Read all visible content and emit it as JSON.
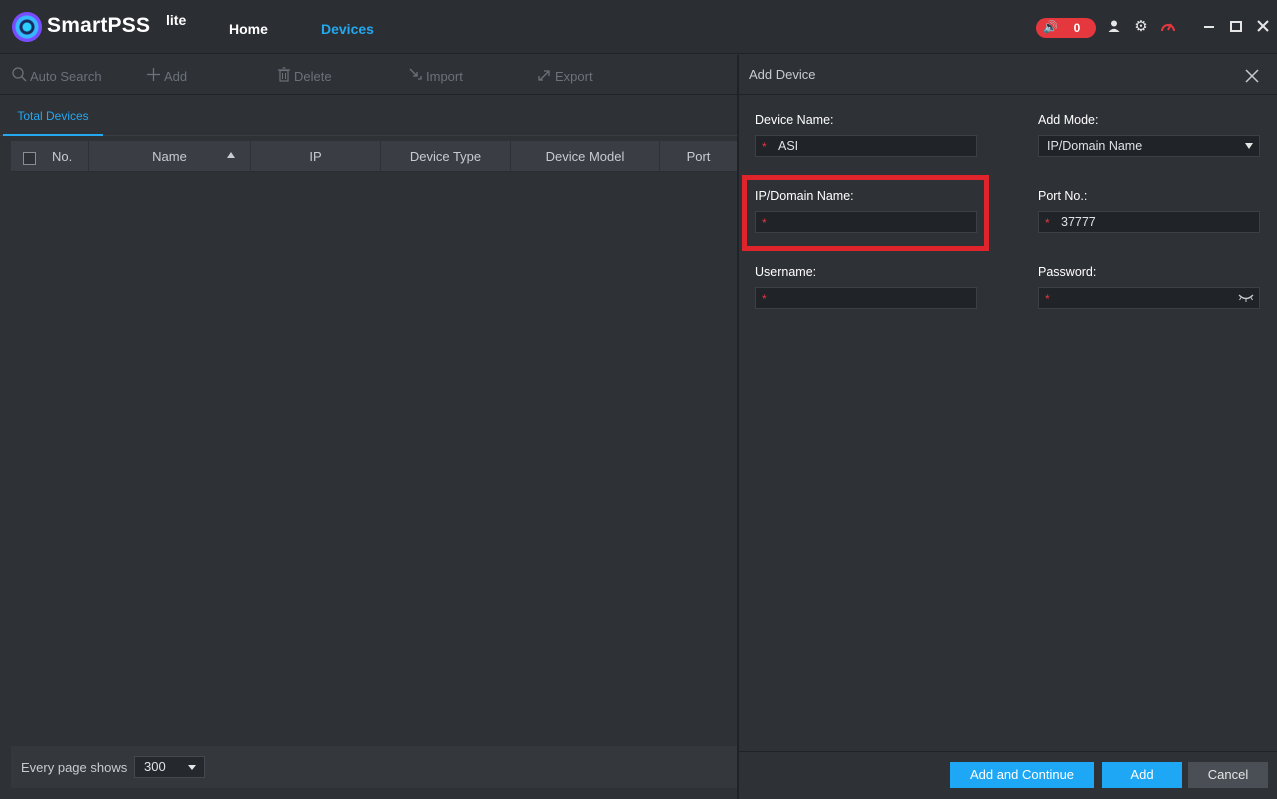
{
  "app": {
    "brand": "SmartPSS",
    "brand_sup": "lite",
    "nav": {
      "home": "Home",
      "devices": "Devices"
    },
    "alarm_count": "0"
  },
  "toolbar": {
    "auto_search": "Auto Search",
    "add": "Add",
    "delete": "Delete",
    "import": "Import",
    "export": "Export"
  },
  "tabs": {
    "total_devices": "Total Devices"
  },
  "table": {
    "columns": [
      "No.",
      "Name",
      "IP",
      "Device Type",
      "Device Model",
      "Port"
    ]
  },
  "footer": {
    "label": "Every page shows",
    "page_size": "300"
  },
  "add_device": {
    "title": "Add Device",
    "device_name_label": "Device Name:",
    "device_name_value": "ASI",
    "add_mode_label": "Add Mode:",
    "add_mode_value": "IP/Domain Name",
    "ip_label": "IP/Domain Name:",
    "ip_value": "",
    "port_label": "Port No.:",
    "port_value": "37777",
    "username_label": "Username:",
    "username_value": "",
    "password_label": "Password:",
    "password_value": "",
    "required_mark": "*",
    "buttons": {
      "add_continue": "Add and Continue",
      "add": "Add",
      "cancel": "Cancel"
    }
  },
  "colors": {
    "accent": "#24a8f0",
    "alarm": "#e5383e",
    "highlight": "#e0242b",
    "background": "#2e3136"
  }
}
